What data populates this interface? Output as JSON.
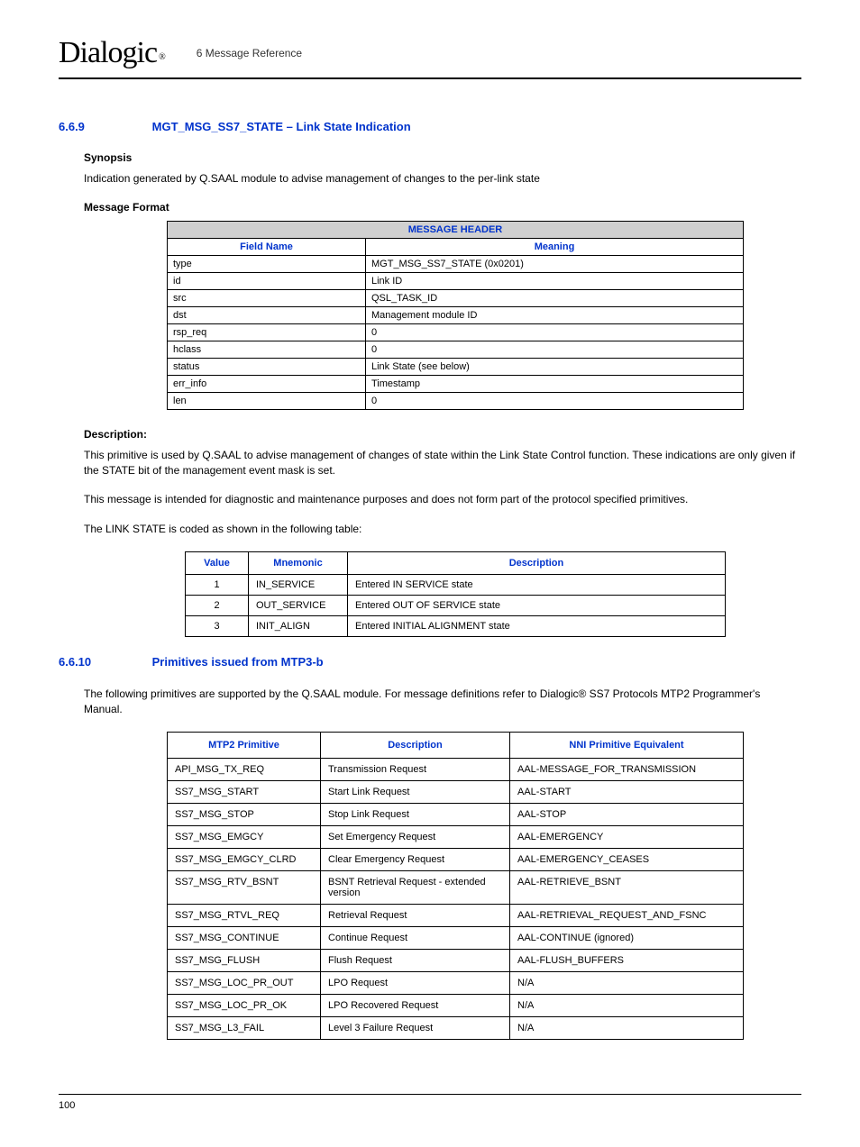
{
  "header": {
    "logo": "Dialogic",
    "chapter": "6 Message Reference"
  },
  "section1": {
    "num": "6.6.9",
    "title": "MGT_MSG_SS7_STATE – Link State Indication",
    "synopsis_label": "Synopsis",
    "synopsis_text": "Indication generated by Q.SAAL module to advise management of changes to the per-link state",
    "format_label": "Message Format",
    "table_header": "MESSAGE HEADER",
    "col_field": "Field Name",
    "col_meaning": "Meaning",
    "rows": [
      {
        "f": "type",
        "m": "MGT_MSG_SS7_STATE (0x0201)"
      },
      {
        "f": "id",
        "m": "Link ID"
      },
      {
        "f": "src",
        "m": "QSL_TASK_ID"
      },
      {
        "f": "dst",
        "m": "Management module ID"
      },
      {
        "f": "rsp_req",
        "m": "0"
      },
      {
        "f": "hclass",
        "m": "0"
      },
      {
        "f": "status",
        "m": "Link State (see below)"
      },
      {
        "f": "err_info",
        "m": "Timestamp"
      },
      {
        "f": "len",
        "m": "0"
      }
    ],
    "desc_label": "Description:",
    "desc_p1": "This primitive is used by Q.SAAL to advise management of changes of state within the Link State Control function. These indications are only given if the STATE bit of the management event mask is set.",
    "desc_p2": "This message is intended for diagnostic and maintenance purposes and does not form part of the protocol specified primitives.",
    "desc_p3": "The LINK STATE is coded as shown in the following table:",
    "t2_col_value": "Value",
    "t2_col_mnem": "Mnemonic",
    "t2_col_desc": "Description",
    "t2_rows": [
      {
        "v": "1",
        "m": "IN_SERVICE",
        "d": "Entered IN SERVICE state"
      },
      {
        "v": "2",
        "m": "OUT_SERVICE",
        "d": "Entered OUT OF SERVICE state"
      },
      {
        "v": "3",
        "m": "INIT_ALIGN",
        "d": "Entered INITIAL ALIGNMENT state"
      }
    ]
  },
  "section2": {
    "num": "6.6.10",
    "title": "Primitives issued from MTP3-b",
    "intro": "The following primitives are supported by the Q.SAAL module. For message definitions refer to Dialogic® SS7 Protocols MTP2 Programmer's Manual.",
    "t3_col_prim": "MTP2 Primitive",
    "t3_col_desc": "Description",
    "t3_col_nni": "NNI Primitive Equivalent",
    "t3_rows": [
      {
        "p": "API_MSG_TX_REQ",
        "d": "Transmission Request",
        "n": "AAL-MESSAGE_FOR_TRANSMISSION"
      },
      {
        "p": "SS7_MSG_START",
        "d": "Start Link Request",
        "n": "AAL-START"
      },
      {
        "p": "SS7_MSG_STOP",
        "d": "Stop Link Request",
        "n": "AAL-STOP"
      },
      {
        "p": "SS7_MSG_EMGCY",
        "d": "Set Emergency Request",
        "n": "AAL-EMERGENCY"
      },
      {
        "p": "SS7_MSG_EMGCY_CLRD",
        "d": "Clear Emergency Request",
        "n": "AAL-EMERGENCY_CEASES"
      },
      {
        "p": "SS7_MSG_RTV_BSNT",
        "d": "BSNT Retrieval Request - extended version",
        "n": "AAL-RETRIEVE_BSNT"
      },
      {
        "p": "SS7_MSG_RTVL_REQ",
        "d": "Retrieval Request",
        "n": "AAL-RETRIEVAL_REQUEST_AND_FSNC"
      },
      {
        "p": "SS7_MSG_CONTINUE",
        "d": "Continue Request",
        "n": "AAL-CONTINUE (ignored)"
      },
      {
        "p": "SS7_MSG_FLUSH",
        "d": "Flush Request",
        "n": "AAL-FLUSH_BUFFERS"
      },
      {
        "p": "SS7_MSG_LOC_PR_OUT",
        "d": "LPO Request",
        "n": "N/A"
      },
      {
        "p": "SS7_MSG_LOC_PR_OK",
        "d": "LPO Recovered Request",
        "n": "N/A"
      },
      {
        "p": "SS7_MSG_L3_FAIL",
        "d": "Level 3 Failure Request",
        "n": "N/A"
      }
    ]
  },
  "page_number": "100"
}
